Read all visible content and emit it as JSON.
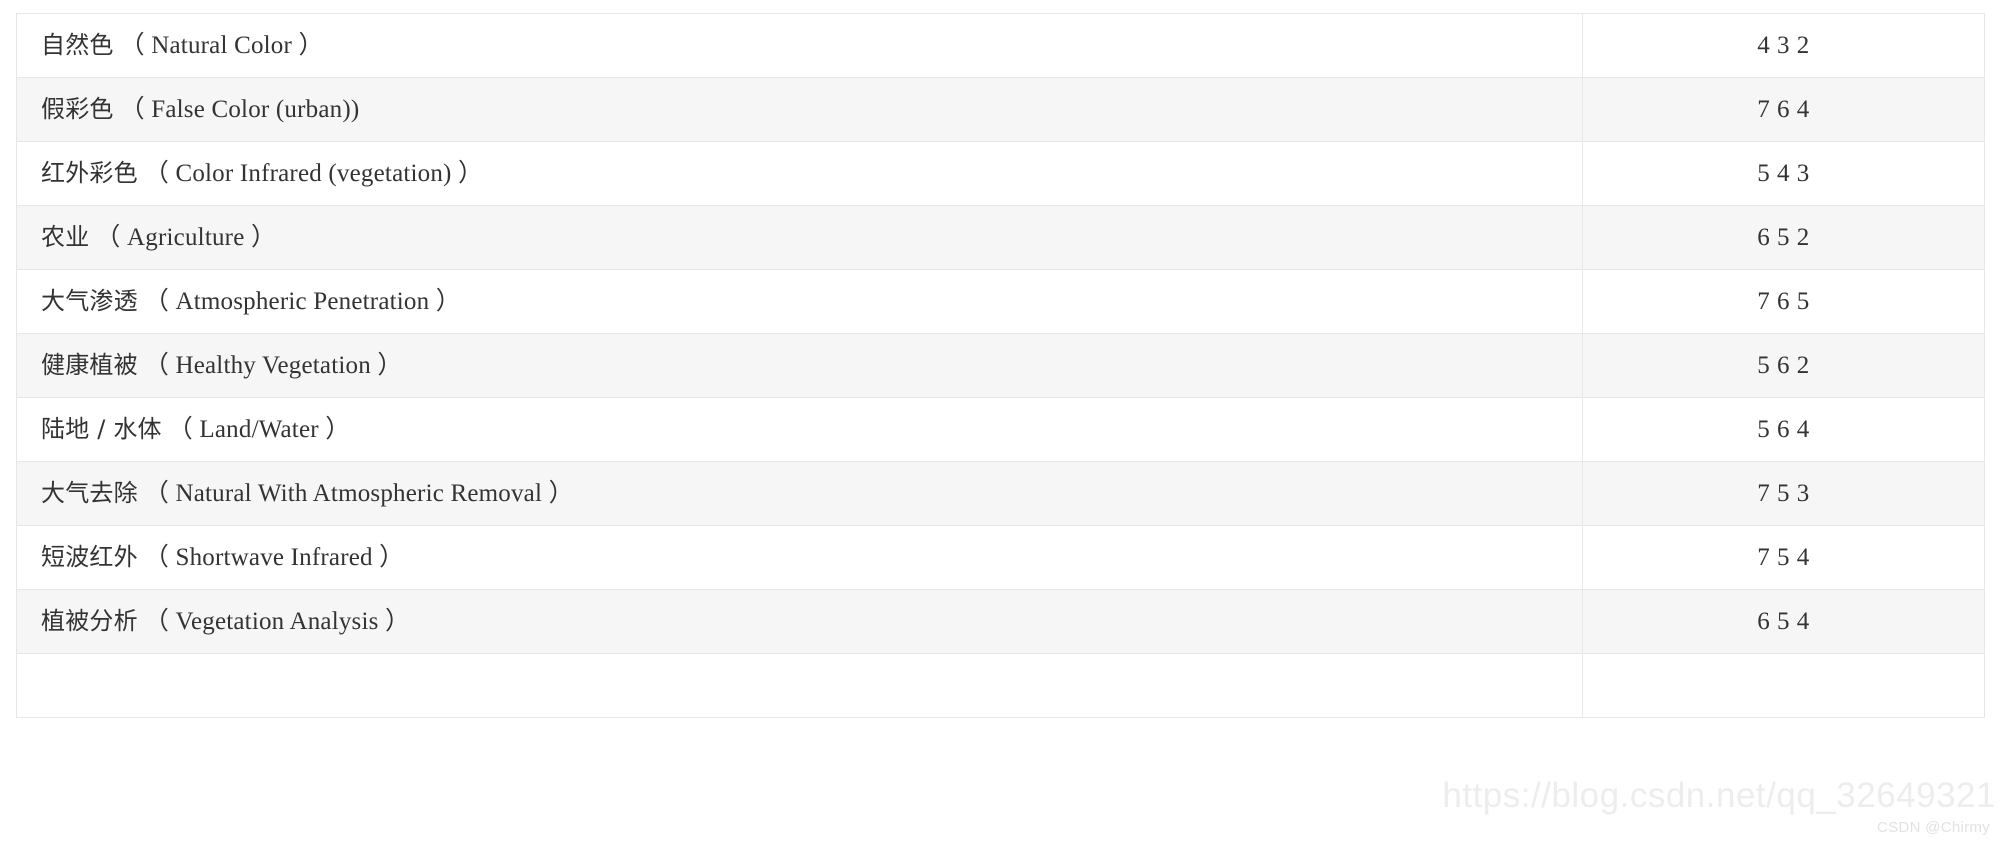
{
  "table": {
    "columns": [
      "",
      ""
    ],
    "rows": [
      {
        "name_cn": "自然色",
        "name_en": "（ Natural Color ）",
        "value": "4 3 2"
      },
      {
        "name_cn": "假彩色",
        "name_en": "（ False Color (urban))",
        "value": "7 6 4"
      },
      {
        "name_cn": "红外彩色",
        "name_en": "（ Color Infrared (vegetation) ）",
        "value": "5 4 3"
      },
      {
        "name_cn": "农业",
        "name_en": "（ Agriculture ）",
        "value": "6 5 2"
      },
      {
        "name_cn": "大气渗透",
        "name_en": "（ Atmospheric Penetration ）",
        "value": "7 6 5"
      },
      {
        "name_cn": "健康植被",
        "name_en": "（ Healthy Vegetation ）",
        "value": "5 6 2"
      },
      {
        "name_cn": "陆地 / 水体",
        "name_en": "（ Land/Water ）",
        "value": "5 6 4"
      },
      {
        "name_cn": "大气去除",
        "name_en": "（ Natural With Atmospheric Removal ）",
        "value": "7 5 3"
      },
      {
        "name_cn": "短波红外",
        "name_en": "（ Shortwave Infrared ）",
        "value": "7 5 4"
      },
      {
        "name_cn": "植被分析",
        "name_en": "（ Vegetation Analysis ）",
        "value": "6 5 4"
      },
      {
        "name_cn": "",
        "name_en": "",
        "value": ""
      }
    ]
  },
  "watermark": {
    "url": "https://blog.csdn.net/qq_32649321",
    "tag": "CSDN @Chirmy"
  },
  "colors": {
    "row_alt_background": "#f6f6f6",
    "row_background": "#ffffff",
    "border": "#e8e8e8",
    "text": "#333333",
    "watermark": "#ededed"
  }
}
